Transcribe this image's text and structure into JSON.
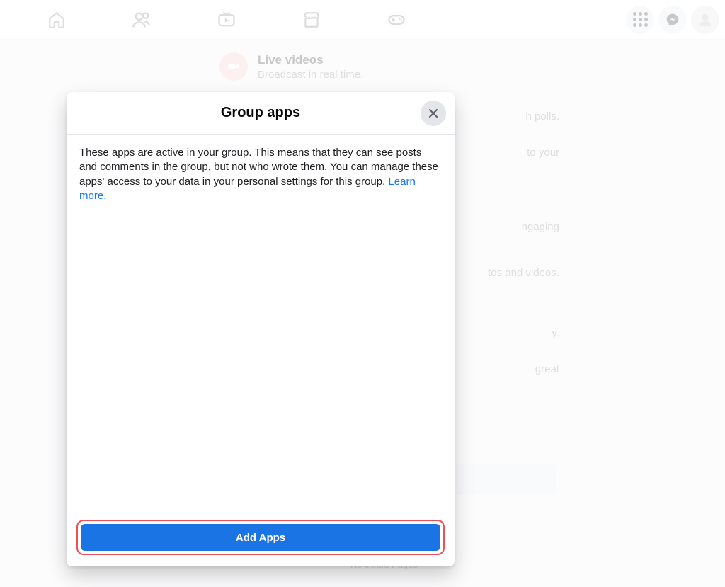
{
  "topnav": {
    "home": "Home",
    "friends": "Friends",
    "watch": "Watch",
    "marketplace": "Marketplace",
    "gaming": "Gaming",
    "menu": "Menu",
    "messenger": "Messenger"
  },
  "features": [
    {
      "title": "Live videos",
      "subtitle": "Broadcast in real time."
    },
    {
      "title": "",
      "subtitle": "h polls."
    },
    {
      "title": "",
      "subtitle": "to your"
    },
    {
      "title": "",
      "subtitle": "ngaging"
    },
    {
      "title": "",
      "subtitle": "tos and videos."
    },
    {
      "title": "",
      "subtitle": "y."
    },
    {
      "title": "",
      "subtitle": "great"
    }
  ],
  "no_linked": "No linked Pages",
  "modal": {
    "title": "Group apps",
    "body_text": "These apps are active in your group. This means that they can see posts and comments in the group, but not who wrote them. You can manage these apps' access to your data in your personal settings for this group. ",
    "learn_more": "Learn more.",
    "add_apps": "Add Apps"
  },
  "colors": {
    "accent": "#1b74e4",
    "link": "#1877f2",
    "danger_outline": "#ef4e57"
  }
}
